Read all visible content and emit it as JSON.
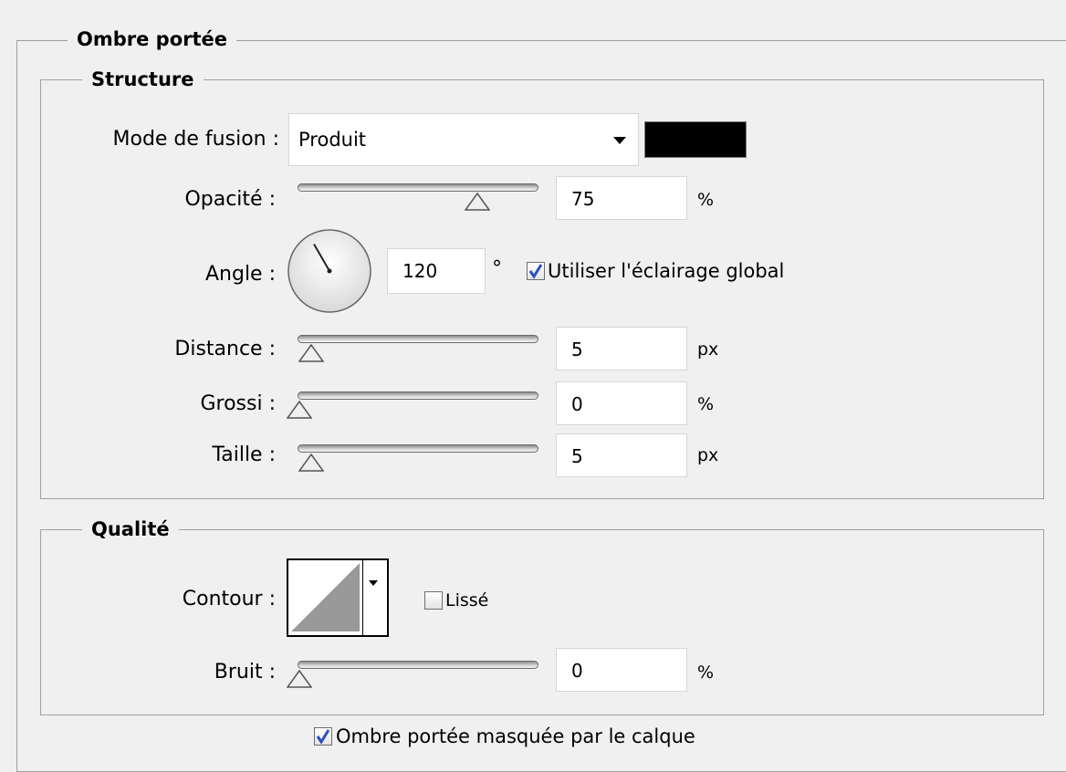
{
  "drop_shadow": {
    "title": "Ombre portée",
    "structure": {
      "title": "Structure",
      "blend_mode": {
        "label": "Mode de fusion :",
        "value": "Produit",
        "color": "#000000"
      },
      "opacity": {
        "label": "Opacité :",
        "value": "75",
        "unit": "%",
        "level": 75
      },
      "angle": {
        "label": "Angle :",
        "value": "120",
        "unit": "°",
        "degrees": 120
      },
      "use_global_light": {
        "label": "Utiliser l'éclairage global",
        "checked": true
      },
      "distance": {
        "label": "Distance :",
        "value": "5",
        "unit": "px",
        "level": 5
      },
      "spread": {
        "label": "Grossi :",
        "value": "0",
        "unit": "%",
        "level": 0
      },
      "size": {
        "label": "Taille :",
        "value": "5",
        "unit": "px",
        "level": 5
      }
    },
    "quality": {
      "title": "Qualité",
      "contour": {
        "label": "Contour :"
      },
      "anti_aliased": {
        "label": "Lissé",
        "checked": false
      },
      "noise": {
        "label": "Bruit :",
        "value": "0",
        "unit": "%",
        "level": 0
      }
    },
    "layer_knocks_out": {
      "label": "Ombre portée masquée par le calque",
      "checked": true
    }
  }
}
